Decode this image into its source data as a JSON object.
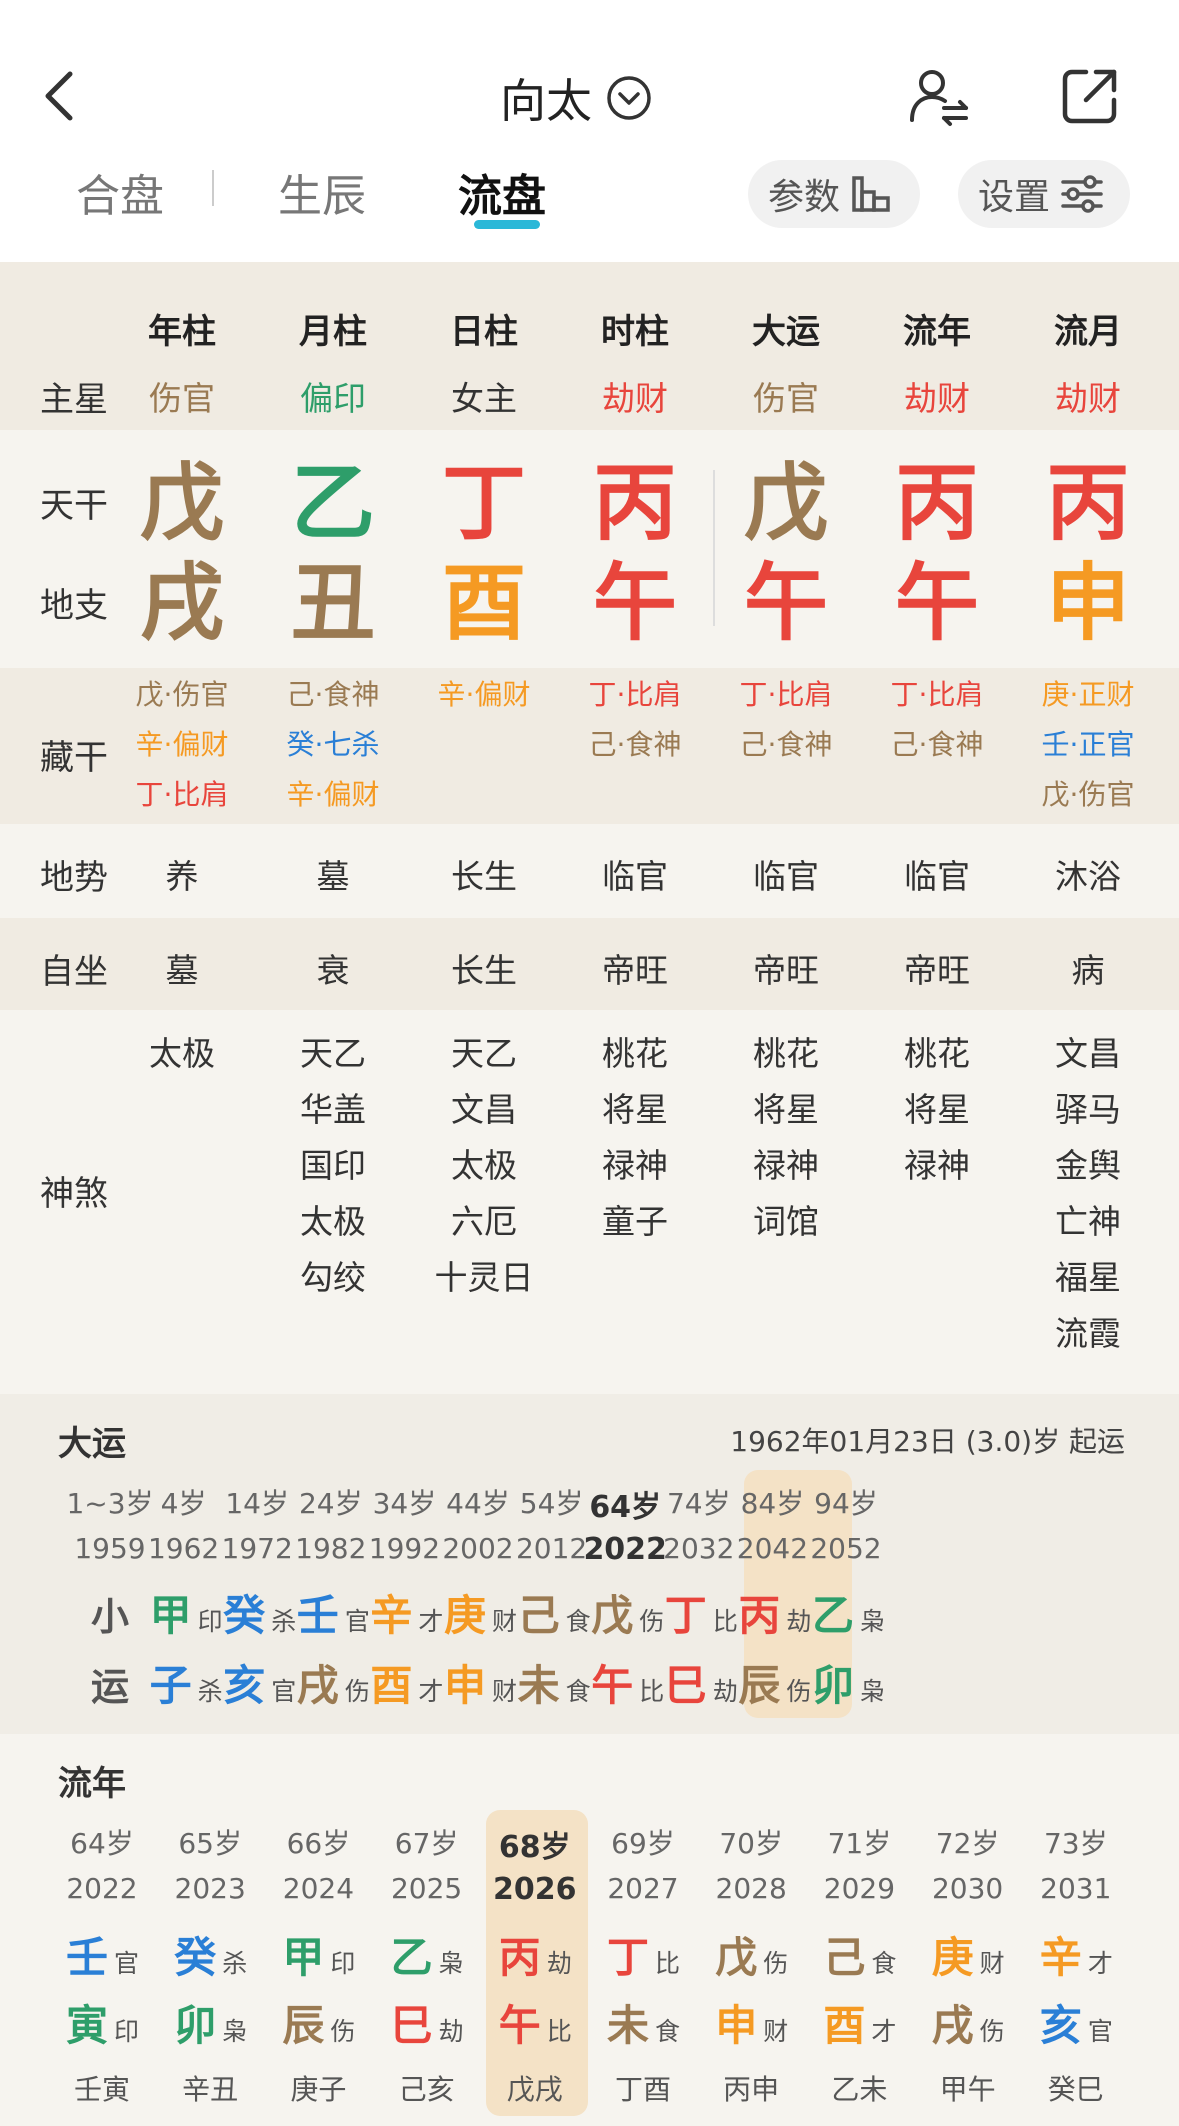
{
  "header": {
    "title": "向太",
    "tabs": [
      {
        "label": "合盘",
        "active": false
      },
      {
        "label": "生辰",
        "active": false
      },
      {
        "label": "流盘",
        "active": true
      }
    ],
    "params_label": "参数",
    "settings_label": "设置"
  },
  "colors": {
    "earth": "#9a7a52",
    "wood": "#2e9e6a",
    "fire": "#e8453c",
    "metal": "#f59a23",
    "water": "#2a7fd6",
    "neutral": "#333333",
    "accent": "#2bb8d8",
    "highlight": "#f4e2c6"
  },
  "chart": {
    "labels": {
      "zhuxing": "主星",
      "tiangan": "天干",
      "dizhi": "地支",
      "canggan": "藏干",
      "dishi": "地势",
      "zizuo": "自坐",
      "shensha": "神煞"
    },
    "columns": [
      {
        "header": "年柱",
        "zhuxing": {
          "text": "伤官",
          "color": "earth"
        },
        "tiangan": {
          "text": "戊",
          "color": "earth"
        },
        "dizhi": {
          "text": "戌",
          "color": "earth"
        },
        "canggan": [
          {
            "text": "戊·伤官",
            "color": "earth"
          },
          {
            "text": "辛·偏财",
            "color": "metal"
          },
          {
            "text": "丁·比肩",
            "color": "fire"
          }
        ],
        "dishi": "养",
        "zizuo": "墓",
        "shensha": [
          "太极"
        ]
      },
      {
        "header": "月柱",
        "zhuxing": {
          "text": "偏印",
          "color": "wood"
        },
        "tiangan": {
          "text": "乙",
          "color": "wood"
        },
        "dizhi": {
          "text": "丑",
          "color": "earth"
        },
        "canggan": [
          {
            "text": "己·食神",
            "color": "earth"
          },
          {
            "text": "癸·七杀",
            "color": "water"
          },
          {
            "text": "辛·偏财",
            "color": "metal"
          }
        ],
        "dishi": "墓",
        "zizuo": "衰",
        "shensha": [
          "天乙",
          "华盖",
          "国印",
          "太极",
          "勾绞"
        ]
      },
      {
        "header": "日柱",
        "zhuxing": {
          "text": "女主",
          "color": "neutral"
        },
        "tiangan": {
          "text": "丁",
          "color": "fire"
        },
        "dizhi": {
          "text": "酉",
          "color": "metal"
        },
        "canggan": [
          {
            "text": "辛·偏财",
            "color": "metal"
          }
        ],
        "dishi": "长生",
        "zizuo": "长生",
        "shensha": [
          "天乙",
          "文昌",
          "太极",
          "六厄",
          "十灵日"
        ]
      },
      {
        "header": "时柱",
        "zhuxing": {
          "text": "劫财",
          "color": "fire"
        },
        "tiangan": {
          "text": "丙",
          "color": "fire"
        },
        "dizhi": {
          "text": "午",
          "color": "fire"
        },
        "canggan": [
          {
            "text": "丁·比肩",
            "color": "fire"
          },
          {
            "text": "己·食神",
            "color": "earth"
          }
        ],
        "dishi": "临官",
        "zizuo": "帝旺",
        "shensha": [
          "桃花",
          "将星",
          "禄神",
          "童子"
        ]
      },
      {
        "header": "大运",
        "zhuxing": {
          "text": "伤官",
          "color": "earth"
        },
        "tiangan": {
          "text": "戊",
          "color": "earth"
        },
        "dizhi": {
          "text": "午",
          "color": "fire"
        },
        "canggan": [
          {
            "text": "丁·比肩",
            "color": "fire"
          },
          {
            "text": "己·食神",
            "color": "earth"
          }
        ],
        "dishi": "临官",
        "zizuo": "帝旺",
        "shensha": [
          "桃花",
          "将星",
          "禄神",
          "词馆"
        ]
      },
      {
        "header": "流年",
        "zhuxing": {
          "text": "劫财",
          "color": "fire"
        },
        "tiangan": {
          "text": "丙",
          "color": "fire"
        },
        "dizhi": {
          "text": "午",
          "color": "fire"
        },
        "canggan": [
          {
            "text": "丁·比肩",
            "color": "fire"
          },
          {
            "text": "己·食神",
            "color": "earth"
          }
        ],
        "dishi": "临官",
        "zizuo": "帝旺",
        "shensha": [
          "桃花",
          "将星",
          "禄神"
        ]
      },
      {
        "header": "流月",
        "zhuxing": {
          "text": "劫财",
          "color": "fire"
        },
        "tiangan": {
          "text": "丙",
          "color": "fire"
        },
        "dizhi": {
          "text": "申",
          "color": "metal"
        },
        "canggan": [
          {
            "text": "庚·正财",
            "color": "metal"
          },
          {
            "text": "壬·正官",
            "color": "water"
          },
          {
            "text": "戊·伤官",
            "color": "earth"
          }
        ],
        "dishi": "沐浴",
        "zizuo": "病",
        "shensha": [
          "文昌",
          "驿马",
          "金舆",
          "亡神",
          "福星",
          "流霞"
        ]
      }
    ]
  },
  "dayun": {
    "title": "大运",
    "qiyun": "1962年01月23日 (3.0)岁 起运",
    "xiaoyun_label": [
      "小",
      "运"
    ],
    "items": [
      {
        "age": "1~3岁",
        "year": "1959",
        "xiaoyun": true
      },
      {
        "age": "4岁",
        "year": "1962",
        "gan": {
          "char": "甲",
          "color": "wood",
          "ss": "印"
        },
        "zhi": {
          "char": "子",
          "color": "water",
          "ss": "杀"
        }
      },
      {
        "age": "14岁",
        "year": "1972",
        "gan": {
          "char": "癸",
          "color": "water",
          "ss": "杀"
        },
        "zhi": {
          "char": "亥",
          "color": "water",
          "ss": "官"
        }
      },
      {
        "age": "24岁",
        "year": "1982",
        "gan": {
          "char": "壬",
          "color": "water",
          "ss": "官"
        },
        "zhi": {
          "char": "戌",
          "color": "earth",
          "ss": "伤"
        }
      },
      {
        "age": "34岁",
        "year": "1992",
        "gan": {
          "char": "辛",
          "color": "metal",
          "ss": "才"
        },
        "zhi": {
          "char": "酉",
          "color": "metal",
          "ss": "才"
        }
      },
      {
        "age": "44岁",
        "year": "2002",
        "gan": {
          "char": "庚",
          "color": "metal",
          "ss": "财"
        },
        "zhi": {
          "char": "申",
          "color": "metal",
          "ss": "财"
        }
      },
      {
        "age": "54岁",
        "year": "2012",
        "gan": {
          "char": "己",
          "color": "earth",
          "ss": "食"
        },
        "zhi": {
          "char": "未",
          "color": "earth",
          "ss": "食"
        }
      },
      {
        "age": "64岁",
        "year": "2022",
        "current": true,
        "gan": {
          "char": "戊",
          "color": "earth",
          "ss": "伤"
        },
        "zhi": {
          "char": "午",
          "color": "fire",
          "ss": "比"
        }
      },
      {
        "age": "74岁",
        "year": "2032",
        "gan": {
          "char": "丁",
          "color": "fire",
          "ss": "比"
        },
        "zhi": {
          "char": "巳",
          "color": "fire",
          "ss": "劫"
        }
      },
      {
        "age": "84岁",
        "year": "2042",
        "gan": {
          "char": "丙",
          "color": "fire",
          "ss": "劫"
        },
        "zhi": {
          "char": "辰",
          "color": "earth",
          "ss": "伤"
        }
      },
      {
        "age": "94岁",
        "year": "2052",
        "gan": {
          "char": "乙",
          "color": "wood",
          "ss": "枭"
        },
        "zhi": {
          "char": "卯",
          "color": "wood",
          "ss": "枭"
        }
      }
    ]
  },
  "liunian": {
    "title": "流年",
    "items": [
      {
        "age": "64岁",
        "year": "2022",
        "gan": {
          "char": "壬",
          "color": "water",
          "ss": "官"
        },
        "zhi": {
          "char": "寅",
          "color": "wood",
          "ss": "印"
        },
        "xiaoyun": "壬寅"
      },
      {
        "age": "65岁",
        "year": "2023",
        "gan": {
          "char": "癸",
          "color": "water",
          "ss": "杀"
        },
        "zhi": {
          "char": "卯",
          "color": "wood",
          "ss": "枭"
        },
        "xiaoyun": "辛丑"
      },
      {
        "age": "66岁",
        "year": "2024",
        "gan": {
          "char": "甲",
          "color": "wood",
          "ss": "印"
        },
        "zhi": {
          "char": "辰",
          "color": "earth",
          "ss": "伤"
        },
        "xiaoyun": "庚子"
      },
      {
        "age": "67岁",
        "year": "2025",
        "gan": {
          "char": "乙",
          "color": "wood",
          "ss": "枭"
        },
        "zhi": {
          "char": "巳",
          "color": "fire",
          "ss": "劫"
        },
        "xiaoyun": "己亥"
      },
      {
        "age": "68岁",
        "year": "2026",
        "current": true,
        "gan": {
          "char": "丙",
          "color": "fire",
          "ss": "劫"
        },
        "zhi": {
          "char": "午",
          "color": "fire",
          "ss": "比"
        },
        "xiaoyun": "戊戌"
      },
      {
        "age": "69岁",
        "year": "2027",
        "gan": {
          "char": "丁",
          "color": "fire",
          "ss": "比"
        },
        "zhi": {
          "char": "未",
          "color": "earth",
          "ss": "食"
        },
        "xiaoyun": "丁酉"
      },
      {
        "age": "70岁",
        "year": "2028",
        "gan": {
          "char": "戊",
          "color": "earth",
          "ss": "伤"
        },
        "zhi": {
          "char": "申",
          "color": "metal",
          "ss": "财"
        },
        "xiaoyun": "丙申"
      },
      {
        "age": "71岁",
        "year": "2029",
        "gan": {
          "char": "己",
          "color": "earth",
          "ss": "食"
        },
        "zhi": {
          "char": "酉",
          "color": "metal",
          "ss": "才"
        },
        "xiaoyun": "乙未"
      },
      {
        "age": "72岁",
        "year": "2030",
        "gan": {
          "char": "庚",
          "color": "metal",
          "ss": "财"
        },
        "zhi": {
          "char": "戌",
          "color": "earth",
          "ss": "伤"
        },
        "xiaoyun": "甲午"
      },
      {
        "age": "73岁",
        "year": "2031",
        "gan": {
          "char": "辛",
          "color": "metal",
          "ss": "才"
        },
        "zhi": {
          "char": "亥",
          "color": "water",
          "ss": "官"
        },
        "xiaoyun": "癸巳"
      }
    ]
  }
}
